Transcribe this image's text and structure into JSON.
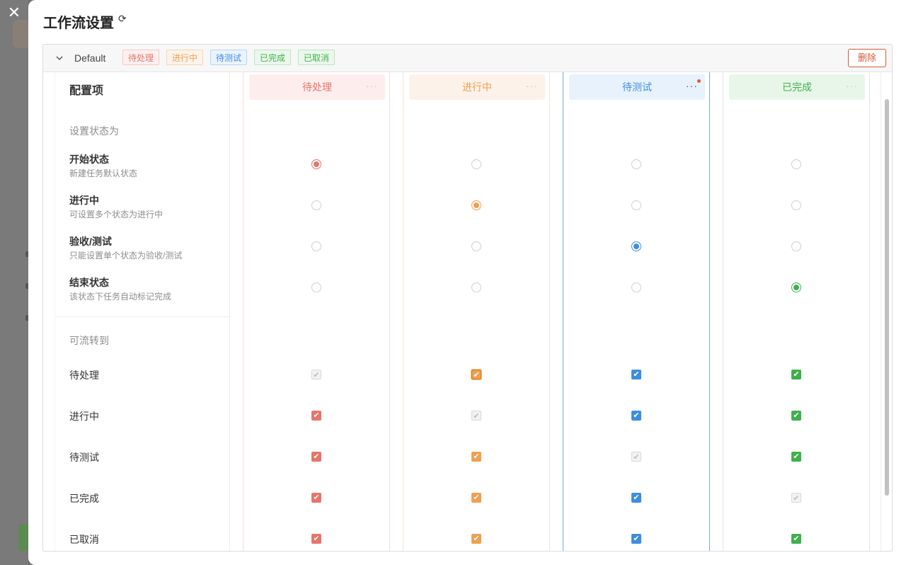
{
  "page_title": "工作流设置",
  "close_glyph": "✕",
  "refresh_glyph": "⟳",
  "workflow": {
    "name": "Default",
    "tags": [
      {
        "label": "待处理",
        "color": "#e8746a",
        "bg": "#fdf0ef",
        "border": "#f5c9c4"
      },
      {
        "label": "进行中",
        "color": "#f0a050",
        "bg": "#fdf3ea",
        "border": "#f6d5b3"
      },
      {
        "label": "待测试",
        "color": "#3d8ee0",
        "bg": "#eaf3fd",
        "border": "#b9d5f4"
      },
      {
        "label": "已完成",
        "color": "#3fb04b",
        "bg": "#ebf7ec",
        "border": "#bfe3c3"
      },
      {
        "label": "已取消",
        "color": "#3fb04b",
        "bg": "#ebf7ec",
        "border": "#bfe3c3"
      }
    ],
    "delete_label": "删除"
  },
  "config_header": "配置项",
  "state_section_label": "设置状态为",
  "state_rows": [
    {
      "title": "开始状态",
      "desc": "新建任务默认状态"
    },
    {
      "title": "进行中",
      "desc": "可设置多个状态为进行中"
    },
    {
      "title": "验收/测试",
      "desc": "只能设置单个状态为验收/测试"
    },
    {
      "title": "结束状态",
      "desc": "该状态下任务自动标记完成"
    }
  ],
  "transition_section_label": "可流转到",
  "transition_rows": [
    "待处理",
    "进行中",
    "待测试",
    "已完成",
    "已取消"
  ],
  "more_glyph": "···",
  "columns": [
    {
      "label": "待处理",
      "color": "#e8746a",
      "head_bg": "#fdeeed",
      "border": "#f8dcd9",
      "selected_state": 0,
      "transitions": [
        null,
        true,
        true,
        true,
        true
      ],
      "has_badge": false
    },
    {
      "label": "进行中",
      "color": "#f0a050",
      "head_bg": "#fdf2ea",
      "border": "#f3e4d7",
      "selected_state": 1,
      "transitions": [
        true,
        null,
        true,
        true,
        true
      ],
      "has_badge": false
    },
    {
      "label": "待测试",
      "color": "#3d8ee0",
      "head_bg": "#e8f2fd",
      "border": "#7aa8d9",
      "selected_state": 2,
      "transitions": [
        true,
        true,
        null,
        true,
        true
      ],
      "has_badge": true
    },
    {
      "label": "已完成",
      "color": "#3fb04b",
      "head_bg": "#e8f6ea",
      "border": "#e3e3e3",
      "selected_state": 3,
      "transitions": [
        true,
        true,
        true,
        null,
        true
      ],
      "has_badge": false
    }
  ],
  "check_glyph": "✔"
}
